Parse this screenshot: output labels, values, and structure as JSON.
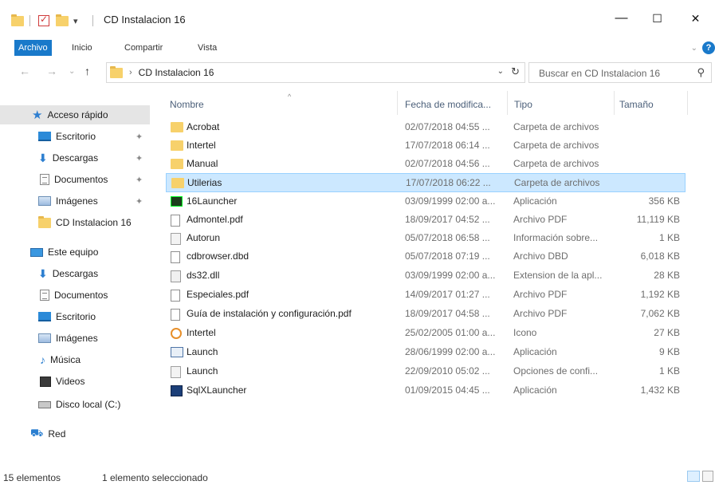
{
  "window": {
    "title": "CD Instalacion 16",
    "minimize": "—",
    "maximize": "☐",
    "close": "✕"
  },
  "quick_access": {
    "dropdown": "▾"
  },
  "ribbon": {
    "tabs": [
      "Archivo",
      "Inicio",
      "Compartir",
      "Vista"
    ],
    "expand": "⌄",
    "help": "?"
  },
  "nav": {
    "back": "←",
    "forward": "→",
    "recent": "⌄",
    "up": "↑",
    "path_sep": "›",
    "path": "CD Instalacion 16",
    "dropdown": "⌄",
    "refresh": "↻",
    "search_placeholder": "Buscar en CD Instalacion 16",
    "search_icon": "⚲"
  },
  "sidebar": {
    "items": [
      {
        "label": "Acceso rápido",
        "icon": "star-icon",
        "pinned": false,
        "selected": true
      },
      {
        "label": "Escritorio",
        "icon": "desktop-icon",
        "pinned": true
      },
      {
        "label": "Descargas",
        "icon": "downloads-icon",
        "pinned": true
      },
      {
        "label": "Documentos",
        "icon": "documents-icon",
        "pinned": true
      },
      {
        "label": "Imágenes",
        "icon": "pictures-icon",
        "pinned": true
      },
      {
        "label": "CD Instalacion 16",
        "icon": "folder-icon",
        "pinned": false
      },
      {
        "label": "Este equipo",
        "icon": "this-pc-icon",
        "pinned": false
      },
      {
        "label": "Descargas",
        "icon": "downloads-icon",
        "pinned": false
      },
      {
        "label": "Documentos",
        "icon": "documents-icon",
        "pinned": false
      },
      {
        "label": "Escritorio",
        "icon": "desktop-icon",
        "pinned": false
      },
      {
        "label": "Imágenes",
        "icon": "pictures-icon",
        "pinned": false
      },
      {
        "label": "Música",
        "icon": "music-icon",
        "pinned": false
      },
      {
        "label": "Videos",
        "icon": "videos-icon",
        "pinned": false
      },
      {
        "label": "Disco local (C:)",
        "icon": "local-disk-icon",
        "pinned": false
      },
      {
        "label": "Red",
        "icon": "network-icon",
        "pinned": false
      }
    ]
  },
  "columns": {
    "name": "Nombre",
    "date": "Fecha de modifica...",
    "type": "Tipo",
    "size": "Tamaño",
    "sort_arrow": "^"
  },
  "files": [
    {
      "name": "Acrobat",
      "date": "02/07/2018 04:55 ...",
      "type": "Carpeta de archivos",
      "size": "",
      "icon": "folder-icon"
    },
    {
      "name": "Intertel",
      "date": "17/07/2018 06:14 ...",
      "type": "Carpeta de archivos",
      "size": "",
      "icon": "folder-icon"
    },
    {
      "name": "Manual",
      "date": "02/07/2018 04:56 ...",
      "type": "Carpeta de archivos",
      "size": "",
      "icon": "folder-icon"
    },
    {
      "name": "Utilerias",
      "date": "17/07/2018 06:22 ...",
      "type": "Carpeta de archivos",
      "size": "",
      "icon": "folder-icon",
      "selected": true
    },
    {
      "name": "16Launcher",
      "date": "03/09/1999 02:00 a...",
      "type": "Aplicación",
      "size": "356 KB",
      "icon": "application-icon"
    },
    {
      "name": "Admontel.pdf",
      "date": "18/09/2017 04:52 ...",
      "type": "Archivo PDF",
      "size": "11,119 KB",
      "icon": "pdf-file-icon"
    },
    {
      "name": "Autorun",
      "date": "05/07/2018 06:58 ...",
      "type": "Información sobre...",
      "size": "1 KB",
      "icon": "setup-info-icon"
    },
    {
      "name": "cdbrowser.dbd",
      "date": "05/07/2018 07:19 ...",
      "type": "Archivo DBD",
      "size": "6,018 KB",
      "icon": "file-icon"
    },
    {
      "name": "ds32.dll",
      "date": "03/09/1999 02:00 a...",
      "type": "Extension de la apl...",
      "size": "28 KB",
      "icon": "dll-file-icon"
    },
    {
      "name": "Especiales.pdf",
      "date": "14/09/2017 01:27 ...",
      "type": "Archivo PDF",
      "size": "1,192 KB",
      "icon": "pdf-file-icon"
    },
    {
      "name": "Guía de instalación y configuración.pdf",
      "date": "18/09/2017 04:58 ...",
      "type": "Archivo PDF",
      "size": "7,062 KB",
      "icon": "pdf-file-icon"
    },
    {
      "name": "Intertel",
      "date": "25/02/2005 01:00 a...",
      "type": "Icono",
      "size": "27 KB",
      "icon": "icon-file-icon"
    },
    {
      "name": "Launch",
      "date": "28/06/1999 02:00 a...",
      "type": "Aplicación",
      "size": "9 KB",
      "icon": "application-icon"
    },
    {
      "name": "Launch",
      "date": "22/09/2010 05:02 ...",
      "type": "Opciones de confi...",
      "size": "1 KB",
      "icon": "config-file-icon"
    },
    {
      "name": "SqlXLauncher",
      "date": "01/09/2015 04:45 ...",
      "type": "Aplicación",
      "size": "1,432 KB",
      "icon": "application-icon"
    }
  ],
  "status": {
    "count": "15 elementos",
    "selection": "1 elemento seleccionado"
  },
  "colors": {
    "accent": "#1979ca",
    "selection_bg": "#cce8ff",
    "selection_border": "#99d1ff",
    "folder": "#f7d16b"
  }
}
